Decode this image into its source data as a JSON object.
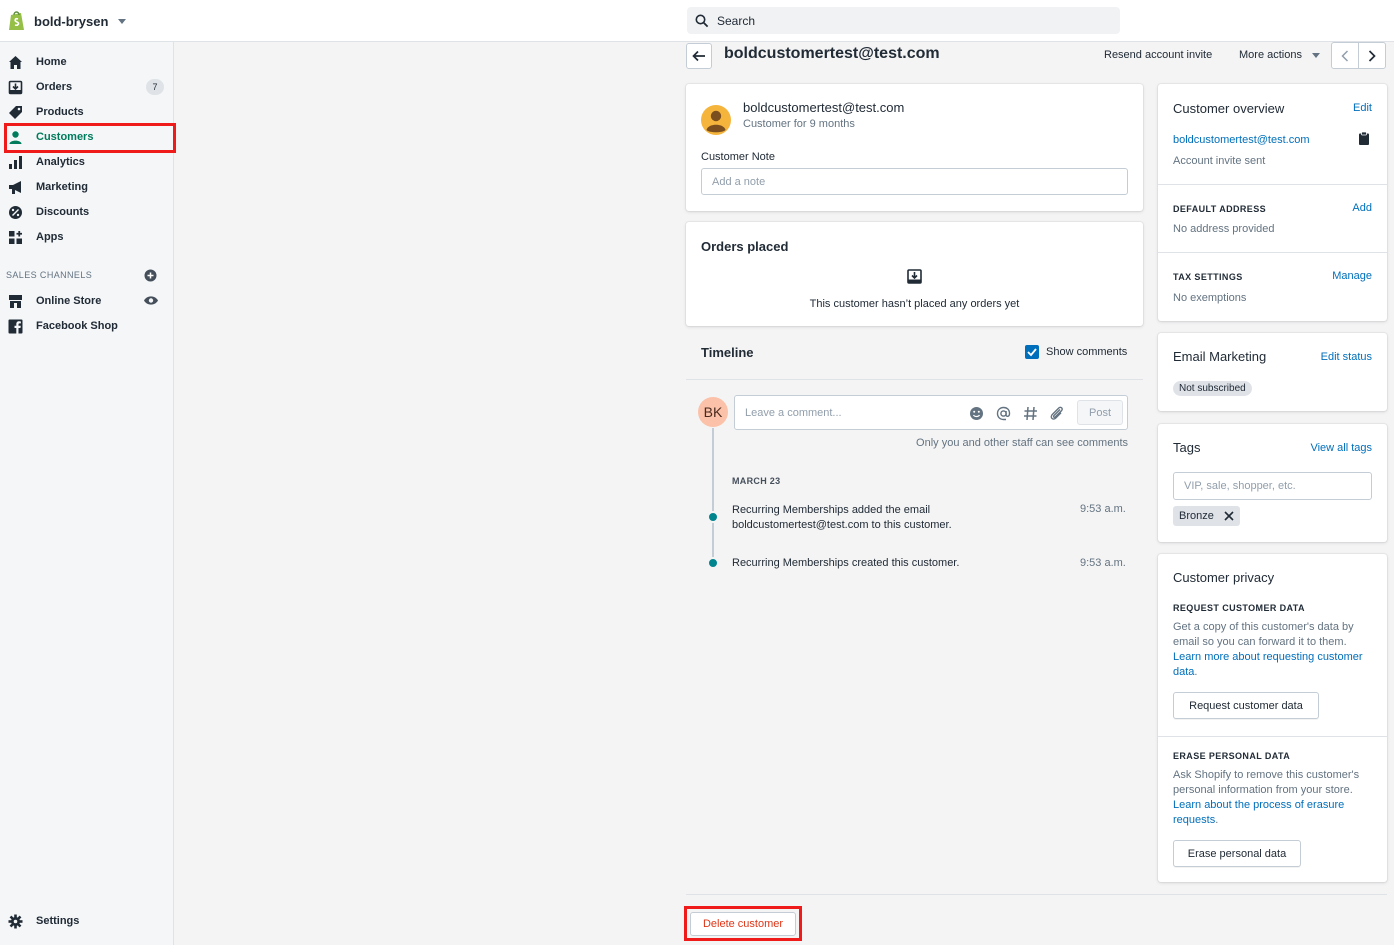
{
  "topbar": {
    "store_name": "bold-brysen",
    "search_placeholder": "Search"
  },
  "sidebar": {
    "items": [
      {
        "label": "Home",
        "icon": "home-icon"
      },
      {
        "label": "Orders",
        "icon": "orders-icon",
        "badge": "7"
      },
      {
        "label": "Products",
        "icon": "tag-icon"
      },
      {
        "label": "Customers",
        "icon": "person-icon",
        "active": true
      },
      {
        "label": "Analytics",
        "icon": "bar-chart-icon"
      },
      {
        "label": "Marketing",
        "icon": "megaphone-icon"
      },
      {
        "label": "Discounts",
        "icon": "discount-icon"
      },
      {
        "label": "Apps",
        "icon": "apps-icon"
      }
    ],
    "channels_heading": "SALES CHANNELS",
    "channels": [
      {
        "label": "Online Store",
        "icon": "store-icon"
      },
      {
        "label": "Facebook Shop",
        "icon": "facebook-icon"
      }
    ],
    "settings_label": "Settings"
  },
  "header": {
    "title": "boldcustomertest@test.com",
    "resend_invite": "Resend account invite",
    "more_actions": "More actions"
  },
  "customer_card": {
    "email": "boldcustomertest@test.com",
    "tenure": "Customer for 9 months",
    "note_label": "Customer Note",
    "note_placeholder": "Add a note"
  },
  "orders_card": {
    "title": "Orders placed",
    "empty_text": "This customer hasn’t placed any orders yet"
  },
  "timeline": {
    "title": "Timeline",
    "show_comments": "Show comments",
    "avatar_initials": "BK",
    "comment_placeholder": "Leave a comment...",
    "post_label": "Post",
    "privacy_note": "Only you and other staff can see comments",
    "date_heading": "MARCH 23",
    "events": [
      {
        "text": "Recurring Memberships added the email boldcustomertest@test.com to this customer.",
        "time": "9:53 a.m."
      },
      {
        "text": "Recurring Memberships created this customer.",
        "time": "9:53 a.m."
      }
    ]
  },
  "overview": {
    "title": "Customer overview",
    "edit": "Edit",
    "email": "boldcustomertest@test.com",
    "invite_status": "Account invite sent",
    "address_heading": "DEFAULT ADDRESS",
    "address_action": "Add",
    "address_value": "No address provided",
    "tax_heading": "TAX SETTINGS",
    "tax_action": "Manage",
    "tax_value": "No exemptions"
  },
  "email_marketing": {
    "title": "Email Marketing",
    "action": "Edit status",
    "status": "Not subscribed"
  },
  "tags": {
    "title": "Tags",
    "action": "View all tags",
    "placeholder": "VIP, sale, shopper, etc.",
    "items": [
      "Bronze"
    ]
  },
  "privacy": {
    "title": "Customer privacy",
    "request_heading": "REQUEST CUSTOMER DATA",
    "request_text": "Get a copy of this customer's data by email so you can forward it to them.",
    "request_link": "Learn more about requesting customer data",
    "request_button": "Request customer data",
    "erase_heading": "ERASE PERSONAL DATA",
    "erase_text": "Ask Shopify to remove this customer's personal information from your store.",
    "erase_link": "Learn about the process of erasure requests",
    "erase_button": "Erase personal data"
  },
  "footer": {
    "delete_label": "Delete customer"
  },
  "colors": {
    "accent_green": "#007b5c",
    "link_blue": "#006fbb",
    "highlight_red": "#ef1b1b",
    "timeline_dot": "#00848e",
    "delete_red": "#de3618"
  }
}
